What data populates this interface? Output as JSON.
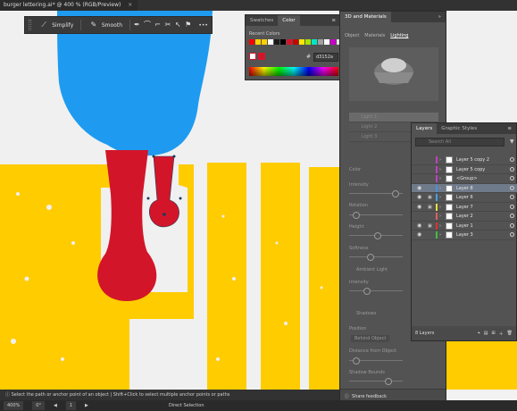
{
  "document": {
    "tab_title": "burger lettering.ai* @ 400 % (RGB/Preview)",
    "close": "×"
  },
  "context_toolbar": {
    "simplify_label": "Simplify",
    "smooth_label": "Smooth",
    "more_label": "•••"
  },
  "color_panel": {
    "tabs": [
      "Swatches",
      "Color"
    ],
    "recent_label": "Recent Colors",
    "hex_value": "d3152a",
    "recent_colors": [
      "#ff0000",
      "#ffd200",
      "#ffd200",
      "#ffffff",
      "#1a1a1a",
      "#000000",
      "#d3152a",
      "#c90000",
      "#ffe600",
      "#a5e600",
      "#00e6c8",
      "#a0a0a0",
      "#ffffff",
      "#c800c8",
      "#e6e6e6",
      "#0000ff"
    ]
  },
  "panel3d": {
    "title": "3D and Materials",
    "tabs": [
      "Object",
      "Materials",
      "Lighting"
    ],
    "lights": [
      "Light 1",
      "Light 2",
      "Light 3"
    ],
    "props": [
      "Color",
      "Intensity",
      "Rotation",
      "Height",
      "Softness",
      "Ambient Light",
      "Intensity",
      "Shadows",
      "Position",
      "Distance from Object",
      "Shadow Bounds"
    ],
    "position_value": "Behind Object",
    "feedback": "Share feedback"
  },
  "layers_panel": {
    "tabs": [
      "Layers",
      "Graphic Styles"
    ],
    "search_placeholder": "Search All",
    "rows": [
      {
        "name": "Layer 5 copy 2",
        "color": "#c040c0",
        "active": false,
        "eye": "",
        "lock": ""
      },
      {
        "name": "Layer 5 copy",
        "color": "#c040c0",
        "active": false,
        "eye": "",
        "lock": ""
      },
      {
        "name": "<Group>",
        "color": "#c040c0",
        "active": false,
        "eye": "",
        "lock": ""
      },
      {
        "name": "Layer 8",
        "color": "#4a90e2",
        "active": true,
        "eye": "◉",
        "lock": ""
      },
      {
        "name": "Layer 6",
        "color": "#4aa0e0",
        "active": false,
        "eye": "◉",
        "lock": "▣"
      },
      {
        "name": "Layer 7",
        "color": "#e8e040",
        "active": false,
        "eye": "◉",
        "lock": "▣"
      },
      {
        "name": "Layer 2",
        "color": "#e06060",
        "active": false,
        "eye": "",
        "lock": ""
      },
      {
        "name": "Layer 1",
        "color": "#e03030",
        "active": false,
        "eye": "◉",
        "lock": "▣"
      },
      {
        "name": "Layer 3",
        "color": "#40c040",
        "active": false,
        "eye": "◉",
        "lock": ""
      }
    ],
    "footer_count": "8 Layers"
  },
  "hint": "Select the path or anchor point of an object  |  Shift+Click to select multiple anchor points or paths",
  "status": {
    "zoom": "400%",
    "rotation": "0°",
    "artboard": "1",
    "tool": "Direct Selection"
  },
  "colors": {
    "blue": "#1e9bf0",
    "yellow": "#ffcc00",
    "red": "#d3152a"
  }
}
